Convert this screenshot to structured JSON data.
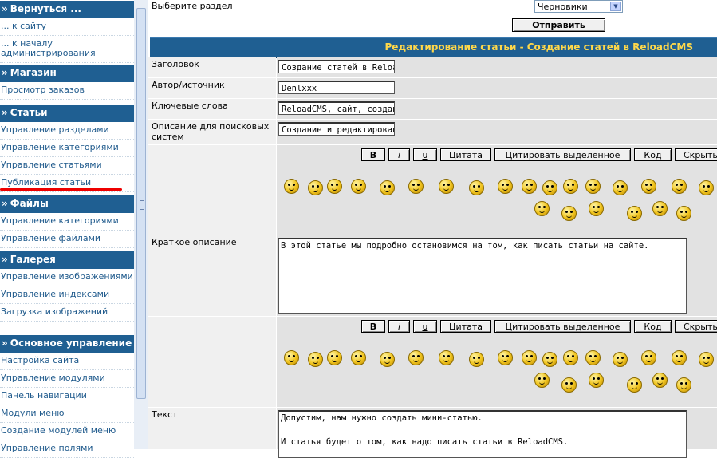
{
  "sidebar": {
    "sections": [
      {
        "title": "Вернуться ...",
        "items": [
          "... к сайту",
          "... к началу администрирования"
        ]
      },
      {
        "title": "Магазин",
        "items": [
          "Просмотр заказов"
        ]
      },
      {
        "title": "Статьи",
        "items": [
          "Управление разделами",
          "Управление категориями",
          "Управление статьями",
          "Публикация статьи"
        ]
      },
      {
        "title": "Файлы",
        "items": [
          "Управление категориями",
          "Управление файлами"
        ]
      },
      {
        "title": "Галерея",
        "items": [
          "Управление изображениями",
          "Управление индексами",
          "Загрузка изображений"
        ]
      },
      {
        "title": "Основное управление",
        "items": [
          "Настройка сайта",
          "Управление модулями",
          "Панель навигации",
          "Модули меню",
          "Создание модулей меню",
          "Управление полями"
        ]
      }
    ],
    "arrow": "»",
    "accent_color": "#1f5f92",
    "highlight_color": "#ee0000"
  },
  "form": {
    "section_label": "Выберите раздел",
    "section_value": "Черновики",
    "submit_label": "Отправить",
    "header": "Редактирование статьи - Создание статей в ReloadCMS",
    "title_label": "Заголовок",
    "title_value": "Создание статей в ReloadCMS",
    "author_label": "Автор/источник",
    "author_value": "Denlxxx",
    "keywords_label": "Ключевые слова",
    "keywords_value": "ReloadCMS, сайт, создание статей",
    "desc_label": "Описание для поисковых систем",
    "desc_value": "Создание и редактирование статей",
    "short_label": "Краткое описание",
    "short_value": "В этой статье мы подробно остановимся на том, как писать статьи на сайте.",
    "text_label": "Текст",
    "text_value": "Допустим, нам нужно создать мини-статью.\n\nИ статья будет о том, как надо писать статьи в ReloadCMS."
  },
  "toolbar": {
    "bold": "B",
    "italic": "i",
    "underline": "u",
    "quote": "Цитата",
    "quote_selected": "Цитировать выделенное",
    "code": "Код",
    "hide": "Скрыть"
  }
}
